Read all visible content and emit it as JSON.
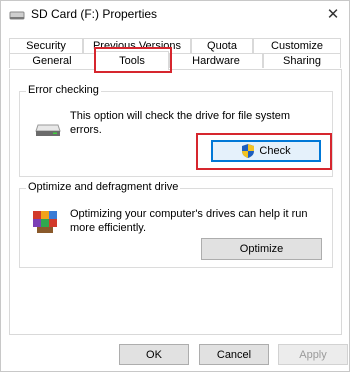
{
  "window": {
    "title": "SD Card (F:) Properties",
    "close_glyph": "✕"
  },
  "tabs": {
    "row1": [
      "Security",
      "Previous Versions",
      "Quota",
      "Customize"
    ],
    "row2": [
      "General",
      "Tools",
      "Hardware",
      "Sharing"
    ],
    "selected": "Tools"
  },
  "error_checking": {
    "title": "Error checking",
    "description": "This option will check the drive for file system errors.",
    "button_label": "Check"
  },
  "optimize": {
    "title": "Optimize and defragment drive",
    "description": "Optimizing your computer's drives can help it run more efficiently.",
    "button_label": "Optimize"
  },
  "footer": {
    "ok_label": "OK",
    "cancel_label": "Cancel",
    "apply_label": "Apply"
  },
  "icons": {
    "window_icon": "drive-icon",
    "error_icon": "drive-icon",
    "optimize_icon": "defrag-icon",
    "check_icon": "shield-icon"
  },
  "colors": {
    "highlight": "#d6262e",
    "focus_blue": "#0078d7"
  }
}
